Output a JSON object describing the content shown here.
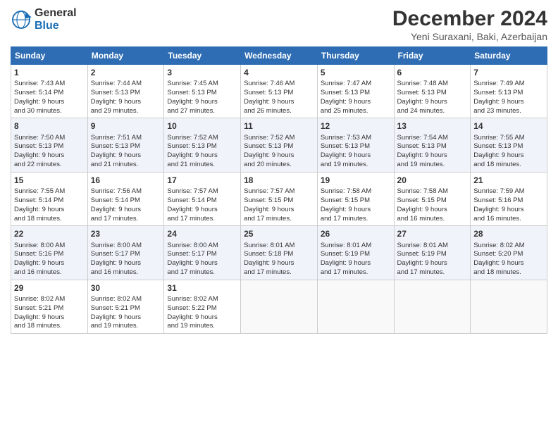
{
  "header": {
    "logo_line1": "General",
    "logo_line2": "Blue",
    "title": "December 2024",
    "subtitle": "Yeni Suraxani, Baki, Azerbaijan"
  },
  "columns": [
    "Sunday",
    "Monday",
    "Tuesday",
    "Wednesday",
    "Thursday",
    "Friday",
    "Saturday"
  ],
  "weeks": [
    [
      {
        "day": "1",
        "lines": [
          "Sunrise: 7:43 AM",
          "Sunset: 5:14 PM",
          "Daylight: 9 hours",
          "and 30 minutes."
        ]
      },
      {
        "day": "2",
        "lines": [
          "Sunrise: 7:44 AM",
          "Sunset: 5:13 PM",
          "Daylight: 9 hours",
          "and 29 minutes."
        ]
      },
      {
        "day": "3",
        "lines": [
          "Sunrise: 7:45 AM",
          "Sunset: 5:13 PM",
          "Daylight: 9 hours",
          "and 27 minutes."
        ]
      },
      {
        "day": "4",
        "lines": [
          "Sunrise: 7:46 AM",
          "Sunset: 5:13 PM",
          "Daylight: 9 hours",
          "and 26 minutes."
        ]
      },
      {
        "day": "5",
        "lines": [
          "Sunrise: 7:47 AM",
          "Sunset: 5:13 PM",
          "Daylight: 9 hours",
          "and 25 minutes."
        ]
      },
      {
        "day": "6",
        "lines": [
          "Sunrise: 7:48 AM",
          "Sunset: 5:13 PM",
          "Daylight: 9 hours",
          "and 24 minutes."
        ]
      },
      {
        "day": "7",
        "lines": [
          "Sunrise: 7:49 AM",
          "Sunset: 5:13 PM",
          "Daylight: 9 hours",
          "and 23 minutes."
        ]
      }
    ],
    [
      {
        "day": "8",
        "lines": [
          "Sunrise: 7:50 AM",
          "Sunset: 5:13 PM",
          "Daylight: 9 hours",
          "and 22 minutes."
        ]
      },
      {
        "day": "9",
        "lines": [
          "Sunrise: 7:51 AM",
          "Sunset: 5:13 PM",
          "Daylight: 9 hours",
          "and 21 minutes."
        ]
      },
      {
        "day": "10",
        "lines": [
          "Sunrise: 7:52 AM",
          "Sunset: 5:13 PM",
          "Daylight: 9 hours",
          "and 21 minutes."
        ]
      },
      {
        "day": "11",
        "lines": [
          "Sunrise: 7:52 AM",
          "Sunset: 5:13 PM",
          "Daylight: 9 hours",
          "and 20 minutes."
        ]
      },
      {
        "day": "12",
        "lines": [
          "Sunrise: 7:53 AM",
          "Sunset: 5:13 PM",
          "Daylight: 9 hours",
          "and 19 minutes."
        ]
      },
      {
        "day": "13",
        "lines": [
          "Sunrise: 7:54 AM",
          "Sunset: 5:13 PM",
          "Daylight: 9 hours",
          "and 19 minutes."
        ]
      },
      {
        "day": "14",
        "lines": [
          "Sunrise: 7:55 AM",
          "Sunset: 5:13 PM",
          "Daylight: 9 hours",
          "and 18 minutes."
        ]
      }
    ],
    [
      {
        "day": "15",
        "lines": [
          "Sunrise: 7:55 AM",
          "Sunset: 5:14 PM",
          "Daylight: 9 hours",
          "and 18 minutes."
        ]
      },
      {
        "day": "16",
        "lines": [
          "Sunrise: 7:56 AM",
          "Sunset: 5:14 PM",
          "Daylight: 9 hours",
          "and 17 minutes."
        ]
      },
      {
        "day": "17",
        "lines": [
          "Sunrise: 7:57 AM",
          "Sunset: 5:14 PM",
          "Daylight: 9 hours",
          "and 17 minutes."
        ]
      },
      {
        "day": "18",
        "lines": [
          "Sunrise: 7:57 AM",
          "Sunset: 5:15 PM",
          "Daylight: 9 hours",
          "and 17 minutes."
        ]
      },
      {
        "day": "19",
        "lines": [
          "Sunrise: 7:58 AM",
          "Sunset: 5:15 PM",
          "Daylight: 9 hours",
          "and 17 minutes."
        ]
      },
      {
        "day": "20",
        "lines": [
          "Sunrise: 7:58 AM",
          "Sunset: 5:15 PM",
          "Daylight: 9 hours",
          "and 16 minutes."
        ]
      },
      {
        "day": "21",
        "lines": [
          "Sunrise: 7:59 AM",
          "Sunset: 5:16 PM",
          "Daylight: 9 hours",
          "and 16 minutes."
        ]
      }
    ],
    [
      {
        "day": "22",
        "lines": [
          "Sunrise: 8:00 AM",
          "Sunset: 5:16 PM",
          "Daylight: 9 hours",
          "and 16 minutes."
        ]
      },
      {
        "day": "23",
        "lines": [
          "Sunrise: 8:00 AM",
          "Sunset: 5:17 PM",
          "Daylight: 9 hours",
          "and 16 minutes."
        ]
      },
      {
        "day": "24",
        "lines": [
          "Sunrise: 8:00 AM",
          "Sunset: 5:17 PM",
          "Daylight: 9 hours",
          "and 17 minutes."
        ]
      },
      {
        "day": "25",
        "lines": [
          "Sunrise: 8:01 AM",
          "Sunset: 5:18 PM",
          "Daylight: 9 hours",
          "and 17 minutes."
        ]
      },
      {
        "day": "26",
        "lines": [
          "Sunrise: 8:01 AM",
          "Sunset: 5:19 PM",
          "Daylight: 9 hours",
          "and 17 minutes."
        ]
      },
      {
        "day": "27",
        "lines": [
          "Sunrise: 8:01 AM",
          "Sunset: 5:19 PM",
          "Daylight: 9 hours",
          "and 17 minutes."
        ]
      },
      {
        "day": "28",
        "lines": [
          "Sunrise: 8:02 AM",
          "Sunset: 5:20 PM",
          "Daylight: 9 hours",
          "and 18 minutes."
        ]
      }
    ],
    [
      {
        "day": "29",
        "lines": [
          "Sunrise: 8:02 AM",
          "Sunset: 5:21 PM",
          "Daylight: 9 hours",
          "and 18 minutes."
        ]
      },
      {
        "day": "30",
        "lines": [
          "Sunrise: 8:02 AM",
          "Sunset: 5:21 PM",
          "Daylight: 9 hours",
          "and 19 minutes."
        ]
      },
      {
        "day": "31",
        "lines": [
          "Sunrise: 8:02 AM",
          "Sunset: 5:22 PM",
          "Daylight: 9 hours",
          "and 19 minutes."
        ]
      },
      {
        "day": "",
        "lines": []
      },
      {
        "day": "",
        "lines": []
      },
      {
        "day": "",
        "lines": []
      },
      {
        "day": "",
        "lines": []
      }
    ]
  ]
}
